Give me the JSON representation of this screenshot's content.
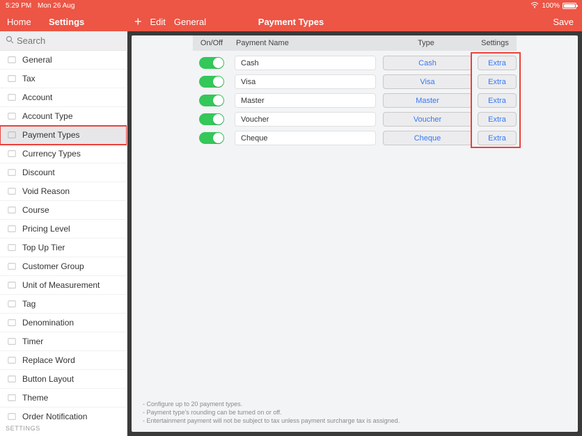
{
  "statusbar": {
    "time": "5:29 PM",
    "date": "Mon 26 Aug",
    "battery": "100%"
  },
  "header": {
    "home": "Home",
    "settings": "Settings",
    "edit": "Edit",
    "general": "General",
    "title": "Payment Types",
    "save": "Save"
  },
  "search": {
    "placeholder": "Search"
  },
  "sidebar": {
    "items": [
      {
        "label": "General"
      },
      {
        "label": "Tax"
      },
      {
        "label": "Account"
      },
      {
        "label": "Account Type"
      },
      {
        "label": "Payment Types",
        "selected": true
      },
      {
        "label": "Currency Types"
      },
      {
        "label": "Discount"
      },
      {
        "label": "Void Reason"
      },
      {
        "label": "Course"
      },
      {
        "label": "Pricing Level"
      },
      {
        "label": "Top Up Tier"
      },
      {
        "label": "Customer Group"
      },
      {
        "label": "Unit of Measurement"
      },
      {
        "label": "Tag"
      },
      {
        "label": "Denomination"
      },
      {
        "label": "Timer"
      },
      {
        "label": "Replace Word"
      },
      {
        "label": "Button Layout"
      },
      {
        "label": "Theme"
      },
      {
        "label": "Order Notification"
      }
    ],
    "footer": "SETTINGS"
  },
  "table": {
    "cols": {
      "onoff": "On/Off",
      "name": "Payment Name",
      "type": "Type",
      "settings": "Settings"
    },
    "rows": [
      {
        "name": "Cash",
        "type": "Cash",
        "extra": "Extra"
      },
      {
        "name": "Visa",
        "type": "Visa",
        "extra": "Extra"
      },
      {
        "name": "Master",
        "type": "Master",
        "extra": "Extra"
      },
      {
        "name": "Voucher",
        "type": "Voucher",
        "extra": "Extra"
      },
      {
        "name": "Cheque",
        "type": "Cheque",
        "extra": "Extra"
      }
    ]
  },
  "footnotes": [
    "Configure up to 20 payment types.",
    "Payment type's rounding can be turned on or off.",
    "Entertainment payment will not be subject to tax unless payment surcharge tax is assigned."
  ]
}
